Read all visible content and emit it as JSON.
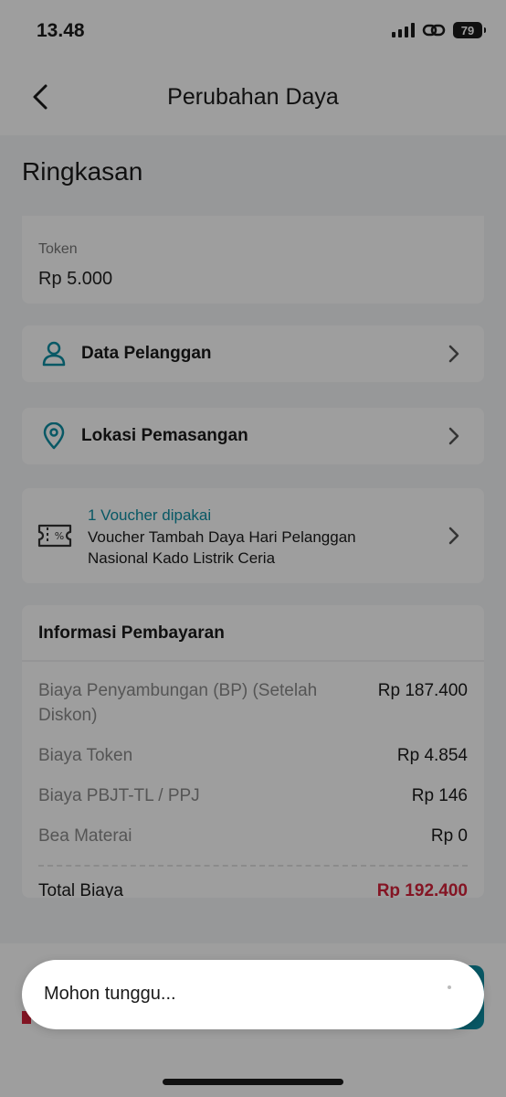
{
  "status_bar": {
    "time": "13.48",
    "battery": "79"
  },
  "header": {
    "title": "Perubahan Daya"
  },
  "section": {
    "title": "Ringkasan"
  },
  "token": {
    "label": "Token",
    "value": "Rp 5.000"
  },
  "nav": {
    "customer_data": "Data Pelanggan",
    "installation_location": "Lokasi Pemasangan"
  },
  "voucher": {
    "count_label": "1 Voucher dipakai",
    "name": "Voucher Tambah Daya Hari Pelanggan Nasional Kado Listrik Ceria"
  },
  "payment": {
    "title": "Informasi Pembayaran",
    "rows": [
      {
        "label": "Biaya Penyambungan (BP) (Setelah Diskon)",
        "value": "Rp 187.400"
      },
      {
        "label": "Biaya Token",
        "value": "Rp 4.854"
      },
      {
        "label": "Biaya PBJT-TL / PPJ",
        "value": "Rp 146"
      },
      {
        "label": "Bea Materai",
        "value": "Rp 0"
      }
    ],
    "total_label": "Total Biaya",
    "total_value": "Rp 192.400"
  },
  "toast": {
    "message": "Mohon tunggu..."
  },
  "colors": {
    "accent": "#0e8fa3",
    "total": "#d6223a"
  },
  "icons": {
    "back": "chevron-left-icon",
    "customer": "user-icon",
    "location": "location-pin-icon",
    "voucher": "voucher-ticket-icon",
    "chevron": "chevron-right-icon"
  }
}
